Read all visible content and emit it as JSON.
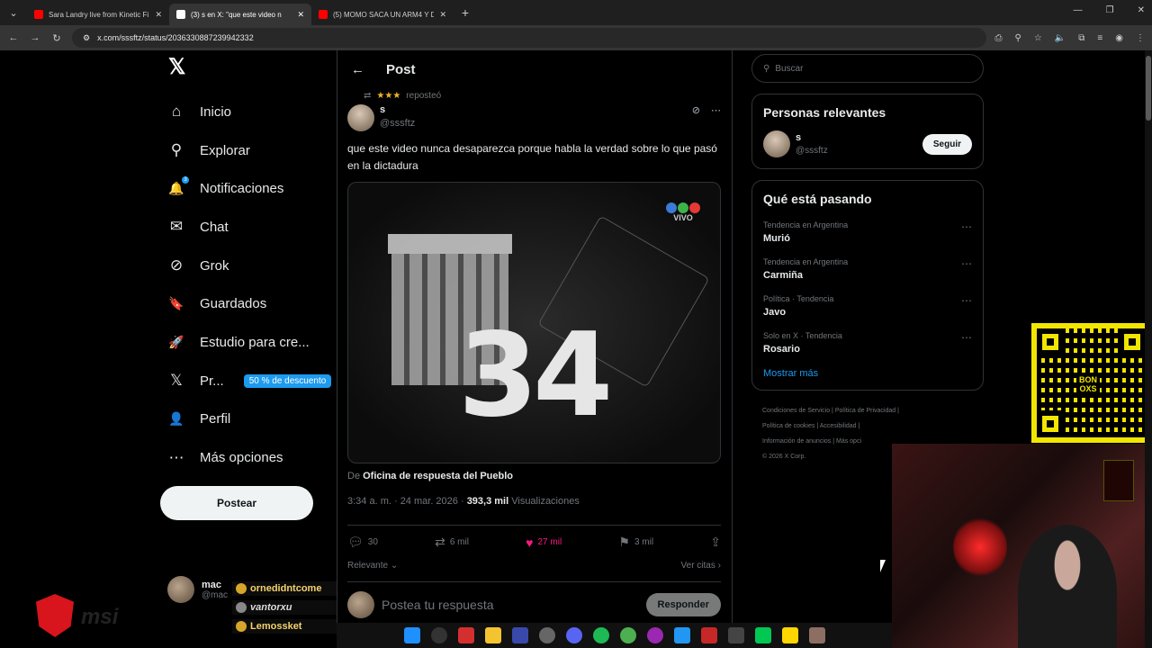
{
  "browser": {
    "tabs": [
      {
        "title": "Sara Landry live from Kinetic Fi",
        "favicon_color": "#ff0000"
      },
      {
        "title": "(3) s en X: \"que este video n",
        "favicon_color": "#ffffff"
      },
      {
        "title": "(5) MOMO SACA UN ARM4 Y D",
        "favicon_color": "#ff0000"
      }
    ],
    "new_tab": "+",
    "url": "x.com/sssftz/status/2036330887239942332"
  },
  "nav": {
    "logo": "𝕏",
    "items": [
      {
        "label": "Inicio",
        "icon": "home-icon",
        "glyph": "⌂"
      },
      {
        "label": "Explorar",
        "icon": "search-icon",
        "glyph": "⚲"
      },
      {
        "label": "Notificaciones",
        "icon": "bell-icon",
        "glyph": "🔔",
        "badge": "3"
      },
      {
        "label": "Chat",
        "icon": "mail-icon",
        "glyph": "✉"
      },
      {
        "label": "Grok",
        "icon": "grok-icon",
        "glyph": "⊘"
      },
      {
        "label": "Guardados",
        "icon": "bookmark-icon",
        "glyph": "🔖"
      },
      {
        "label": "Estudio para cre...",
        "icon": "rocket-icon",
        "glyph": "🚀"
      },
      {
        "label": "Pr...",
        "icon": "x-premium-icon",
        "glyph": "𝕏",
        "promo": "50 % de descuento"
      },
      {
        "label": "Perfil",
        "icon": "person-icon",
        "glyph": "👤"
      },
      {
        "label": "Más opciones",
        "icon": "more-circle-icon",
        "glyph": "⋯"
      }
    ],
    "post_button": "Postear",
    "account": {
      "name": "mac",
      "handle": "@mac"
    }
  },
  "post": {
    "header_title": "Post",
    "repost_label": "reposteó",
    "author_name": "s",
    "author_handle": "@sssftz",
    "text": "que este video nunca desaparezca porque habla la verdad sobre lo que pasó en la dictadura",
    "media": {
      "overlay_text": "34",
      "channel_label": "VIVO"
    },
    "from_prefix": "De",
    "from_source": "Oficina de respuesta del Pueblo",
    "timestamp": "3:34 a. m. · 24 mar. 2026 ·",
    "views_count": "393,3 mil",
    "views_label": "Visualizaciones",
    "stats": {
      "replies": "30",
      "reposts": "6 mil",
      "likes": "27 mil",
      "bookmarks": "3 mil"
    },
    "sort_label": "Relevante",
    "quotes_label": "Ver citas",
    "reply_placeholder": "Postea tu respuesta",
    "reply_button": "Responder"
  },
  "sidebar": {
    "search_placeholder": "Buscar",
    "relevant_title": "Personas relevantes",
    "person": {
      "name": "s",
      "handle": "@sssftz",
      "follow": "Seguir"
    },
    "trends_title": "Qué está pasando",
    "trends": [
      {
        "context": "Tendencia en Argentina",
        "name": "Murió"
      },
      {
        "context": "Tendencia en Argentina",
        "name": "Carmiña"
      },
      {
        "context": "Política · Tendencia",
        "name": "Javo"
      },
      {
        "context": "Solo en X · Tendencia",
        "name": "Rosario"
      }
    ],
    "show_more": "Mostrar más",
    "footer": {
      "line1a": "Condiciones de Servicio",
      "line1b": "Política de Privacidad",
      "line2a": "Política de cookies",
      "line2b": "Accesibilidad",
      "line3a": "Información de anuncios",
      "line3b": "Más opci",
      "copyright": "© 2026 X Corp."
    }
  },
  "overlay": {
    "qr_label": "BON\nOXS",
    "msi_text": "msi",
    "chat": [
      "ornedidntcome",
      "vantorxu",
      "Lemossket"
    ]
  }
}
